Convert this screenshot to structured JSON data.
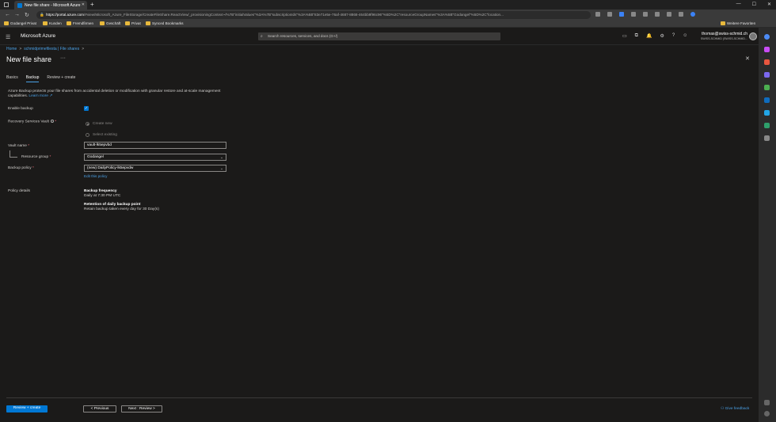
{
  "browser": {
    "tab_title": "New file share - Microsoft Azure",
    "new_tab": "+",
    "url_domain": "https://portal.azure.com",
    "url_rest": "/#view/Microsoft_Azure_FileStorage/CreateFileShare.ReactView/_provisioningContext~/%7B\"initialValues\"%3A%7B\"subscriptionIds\"%3A%5B\"83e71e5e-76af-4687-8868-464bb9f96c96\"%5D%2C\"resourceGroupNames\"%3A%5B\"Godangel\"%5D%2C\"location...",
    "bookmarks": [
      "Godangel Privat",
      "Kunden",
      "Fremdfirmen",
      "Geschäft",
      "Privat",
      "Synced Bookmarks"
    ],
    "other_favorites": "Weitere Favoriten"
  },
  "azure": {
    "brand": "Microsoft Azure",
    "search_placeholder": "Search resources, services, and docs (G+/)",
    "account_email": "thomas@swiss-schmid.ch",
    "account_directory": "SWISS-SCHMID (SWISS-SCHMID..."
  },
  "breadcrumb": [
    "Home",
    "schmidprimefilesta | File shares"
  ],
  "page": {
    "title": "New file share",
    "more": "···",
    "close": "✕"
  },
  "tabs": [
    "Basics",
    "Backup",
    "Review + create"
  ],
  "form": {
    "intro": "Azure Backup protects your file shares from accidental deletion or modification with granular restore and at-scale management capabilities.",
    "learn_more": "Learn more",
    "enable_backup_label": "Enable backup",
    "enable_backup_checked": true,
    "vault_label": "Recovery Services Vault",
    "radio_create_new": "Create new",
    "radio_select_existing": "Select existing",
    "vault_name_label": "Vault name",
    "vault_name_value": "vault-lk5epvbd",
    "resource_group_label": "Resource group",
    "resource_group_value": "Godangel",
    "backup_policy_label": "Backup policy",
    "backup_policy_value": "(new) DailyPolicy-lk5epvdw",
    "edit_policy": "Edit this policy",
    "required_mark": "*"
  },
  "policy_details": {
    "label": "Policy details",
    "frequency_heading": "Backup frequency",
    "frequency_value": "Daily at 7:30 PM UTC",
    "retention_heading": "Retention of daily backup point",
    "retention_value": "Retain backup taken every day for 30 Day(s)"
  },
  "footer": {
    "review_create": "Review + create",
    "previous": "< Previous",
    "next": "Next : Review >",
    "feedback": "Give feedback"
  },
  "colors": {
    "accent": "#0078d4",
    "link": "#4aa0e6",
    "background": "#1b1a19"
  }
}
